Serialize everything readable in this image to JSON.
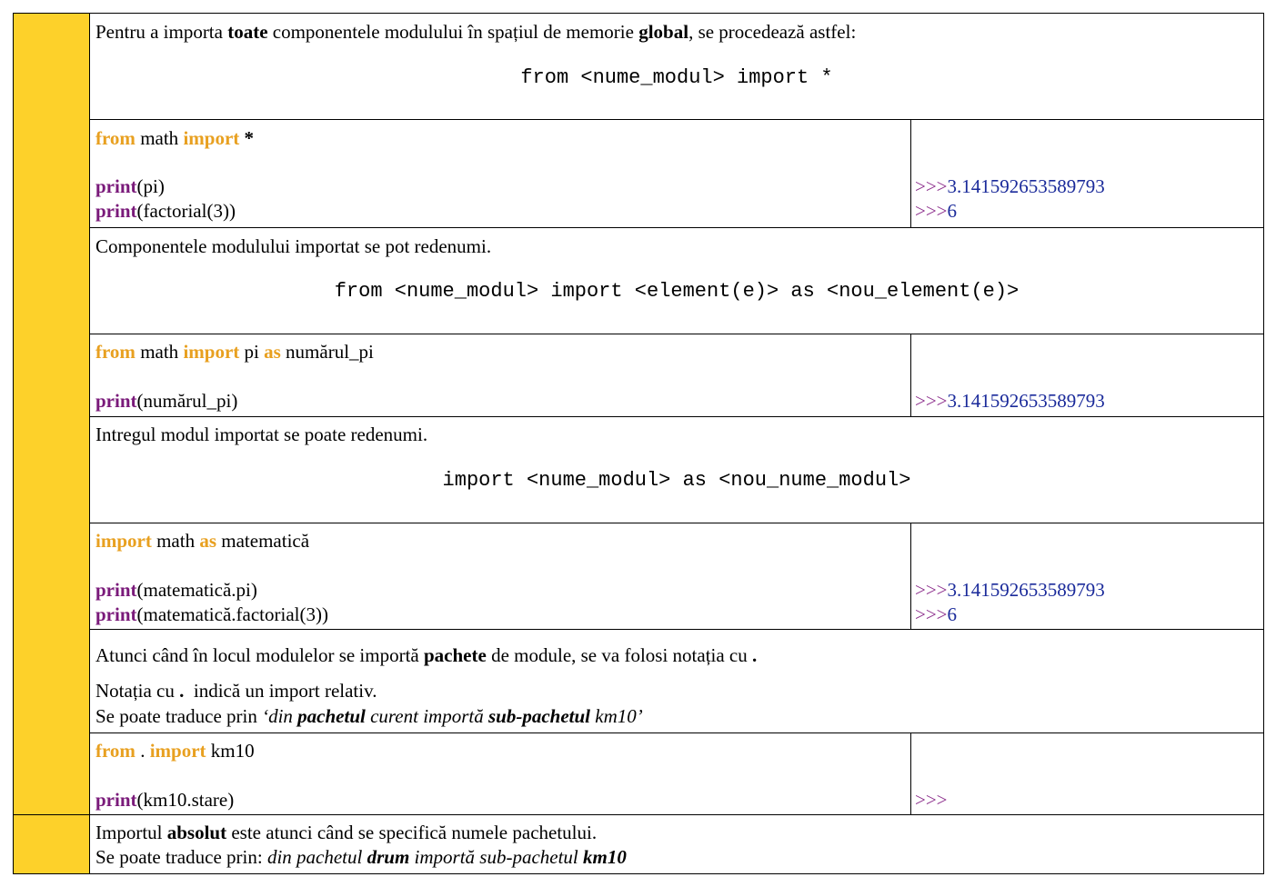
{
  "section1": {
    "intro_before": "Pentru a importa ",
    "intro_bold1": "toate",
    "intro_mid": " componentele modulului în spațiul de memorie ",
    "intro_bold2": "global",
    "intro_after": ", se procedează astfel:",
    "syntax": "from <nume_modul> import *"
  },
  "example1": {
    "kw_from": "from",
    "module": " math ",
    "kw_import": "import",
    "star": " *",
    "print_kw": "print",
    "arg1": "(pi)",
    "arg2": "(factorial(3))",
    "prompt": ">>>",
    "out1": "3.141592653589793",
    "out2": "6"
  },
  "section2": {
    "text": "Componentele modulului importat se pot redenumi.",
    "syntax": "from <nume_modul> import <element(e)> as <nou_element(e)>"
  },
  "example2": {
    "kw_from": "from",
    "module": " math ",
    "kw_import": "import",
    "name": " pi ",
    "kw_as": "as",
    "alias": " numărul_pi",
    "print_kw": "print",
    "arg1": "(numărul_pi)",
    "prompt": ">>>",
    "out1": "3.141592653589793"
  },
  "section3": {
    "text": "Intregul modul importat se poate redenumi.",
    "syntax": "import <nume_modul> as <nou_nume_modul>"
  },
  "example3": {
    "kw_import": "import",
    "module": " math ",
    "kw_as": "as",
    "alias": " matematică",
    "print_kw": "print",
    "arg1": "(matematică.pi)",
    "arg2": "(matematică.factorial(3))",
    "prompt": ">>>",
    "out1": "3.141592653589793",
    "out2": "6"
  },
  "section4": {
    "l1_before": "Atunci când în locul modulelor se importă ",
    "l1_bold": "pachete",
    "l1_after": " de module, se va folosi notația cu ",
    "l1_dot": ".",
    "l2_before": "Notația cu ",
    "l2_dot": ".",
    "l2_after": "  indică un import relativ.",
    "l3_before": "Se poate traduce prin ",
    "l3_i1": "‘din ",
    "l3_b1": "pachetul",
    "l3_i2": " curent importă ",
    "l3_b2": "sub-pachetul",
    "l3_i3": " km10’"
  },
  "example4": {
    "kw_from": "from",
    "dot": " . ",
    "kw_import": "import",
    "module": " km10",
    "print_kw": "print",
    "arg1": "(km10.stare)",
    "prompt": ">>>"
  },
  "section5": {
    "l1_before": "Importul ",
    "l1_bold": "absolut",
    "l1_after": " este atunci când se specifică numele pachetului.",
    "l2_before": "Se poate traduce prin: ",
    "l2_i1": "din pachetul ",
    "l2_b1": "drum",
    "l2_i2": " importă sub-pachetul ",
    "l2_b2": "km10"
  },
  "colors": {
    "margin": "#fdd12a",
    "keyword": "#e8a020",
    "function": "#7a1a7a",
    "output": "#1a2a9a"
  }
}
